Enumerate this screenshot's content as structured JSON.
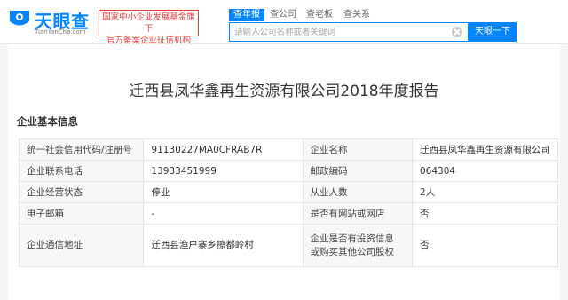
{
  "header": {
    "logo_text": "天眼查",
    "logo_sub": "TianYanCha.com",
    "notice_line1": "国家中小企业发展基金旗下",
    "notice_line2": "官方备案企业征信机构",
    "tabs": [
      {
        "label": "查年报",
        "active": true
      },
      {
        "label": "查公司",
        "active": false
      },
      {
        "label": "查老板",
        "active": false
      },
      {
        "label": "查关系",
        "active": false
      }
    ],
    "search_placeholder": "请输入公司名称或者关键词",
    "search_button": "天眼一下"
  },
  "report": {
    "title": "迁西县凤华鑫再生资源有限公司2018年度报告",
    "section_title": "企业基本信息"
  },
  "table": {
    "rows": [
      {
        "l1": "统一社会信用代码/注册号",
        "v1": "91130227MA0CFRAB7R",
        "l2": "企业名称",
        "v2": "迁西县凤华鑫再生资源有限公司"
      },
      {
        "l1": "企业联系电话",
        "v1": "13933451999",
        "l2": "邮政编码",
        "v2": "064304"
      },
      {
        "l1": "企业经营状态",
        "v1": "停业",
        "l2": "从业人数",
        "v2": "2人"
      },
      {
        "l1": "电子邮箱",
        "v1": "-",
        "l2": "是否有网站或网店",
        "v2": "否"
      },
      {
        "l1": "企业通信地址",
        "v1": "迁西县渔户寨乡擦都岭村",
        "l2a": "企业是否有投资信息",
        "l2b": "或购买其他公司股权",
        "v2": "否"
      }
    ]
  },
  "colors": {
    "brand": "#0084ff",
    "notice": "#e93b3b"
  }
}
